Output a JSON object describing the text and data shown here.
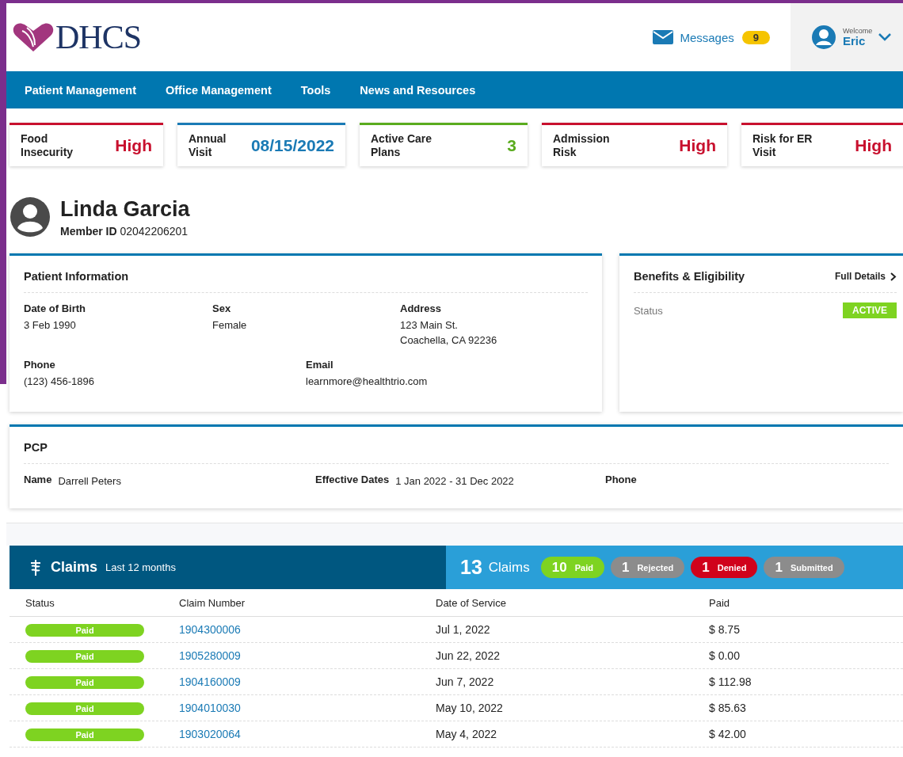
{
  "header": {
    "logo_text": "DHCS",
    "messages": {
      "label": "Messages",
      "count": "9"
    },
    "user": {
      "greeting": "Welcome",
      "name": "Eric"
    }
  },
  "nav": [
    "Patient Management",
    "Office Management",
    "Tools",
    "News and Resources"
  ],
  "alerts": [
    {
      "label": "Food Insecurity",
      "value": "High",
      "color": "#c8102e"
    },
    {
      "label": "Annual Visit",
      "value": "08/15/2022",
      "color": "#1a7ab5"
    },
    {
      "label": "Active Care Plans",
      "value": "3",
      "color": "#5aab1e"
    },
    {
      "label": "Admission Risk",
      "value": "High",
      "color": "#c8102e"
    },
    {
      "label": "Risk for ER Visit",
      "value": "High",
      "color": "#c8102e"
    }
  ],
  "patient": {
    "name": "Linda Garcia",
    "member_id_label": "Member ID",
    "member_id": "02042206201"
  },
  "patient_information": {
    "title": "Patient Information",
    "fields": [
      {
        "label": "Date of Birth",
        "value": [
          "3 Feb 1990"
        ]
      },
      {
        "label": "Sex",
        "value": [
          "Female"
        ]
      },
      {
        "label": "Address",
        "value": [
          "123 Main St.",
          "Coachella, CA 92236"
        ]
      },
      {
        "label": "Phone",
        "value": [
          "(123) 456-1896"
        ]
      },
      {
        "label": "Email",
        "value": [
          "learnmore@healthtrio.com"
        ]
      }
    ]
  },
  "benefits": {
    "title": "Benefits & Eligibility",
    "link": "Full Details",
    "status_label": "Status",
    "status": "ACTIVE"
  },
  "pcp": {
    "title": "PCP",
    "fields": [
      {
        "label": "Name",
        "value": "Darrell Peters"
      },
      {
        "label": "Effective Dates",
        "value": "1 Jan 2022 - 31 Dec 2022"
      },
      {
        "label": "Phone"
      }
    ]
  },
  "claims": {
    "title": "Claims",
    "subtitle": "Last 12 months",
    "total": "13",
    "total_label": "Claims",
    "summary": [
      {
        "count": "10",
        "label": "Paid",
        "color": "#7ed321"
      },
      {
        "count": "1",
        "label": "Rejected",
        "color": "#8c8c8c"
      },
      {
        "count": "1",
        "label": "Denied",
        "color": "#d0021b"
      },
      {
        "count": "1",
        "label": "Submitted",
        "color": "#8c8c8c"
      }
    ],
    "columns": [
      "Status",
      "Claim Number",
      "Date of Service",
      "Paid"
    ],
    "rows": [
      {
        "status": "Paid",
        "claim_number": "1904300006",
        "date": "Jul 1, 2022",
        "paid": "$ 8.75"
      },
      {
        "status": "Paid",
        "claim_number": "1905280009",
        "date": "Jun 22, 2022",
        "paid": "$ 0.00"
      },
      {
        "status": "Paid",
        "claim_number": "1904160009",
        "date": "Jun 7, 2022",
        "paid": "$ 112.98"
      },
      {
        "status": "Paid",
        "claim_number": "1904010030",
        "date": "May 10, 2022",
        "paid": "$ 85.63"
      },
      {
        "status": "Paid",
        "claim_number": "1903020064",
        "date": "May 4, 2022",
        "paid": "$ 42.00"
      }
    ]
  }
}
